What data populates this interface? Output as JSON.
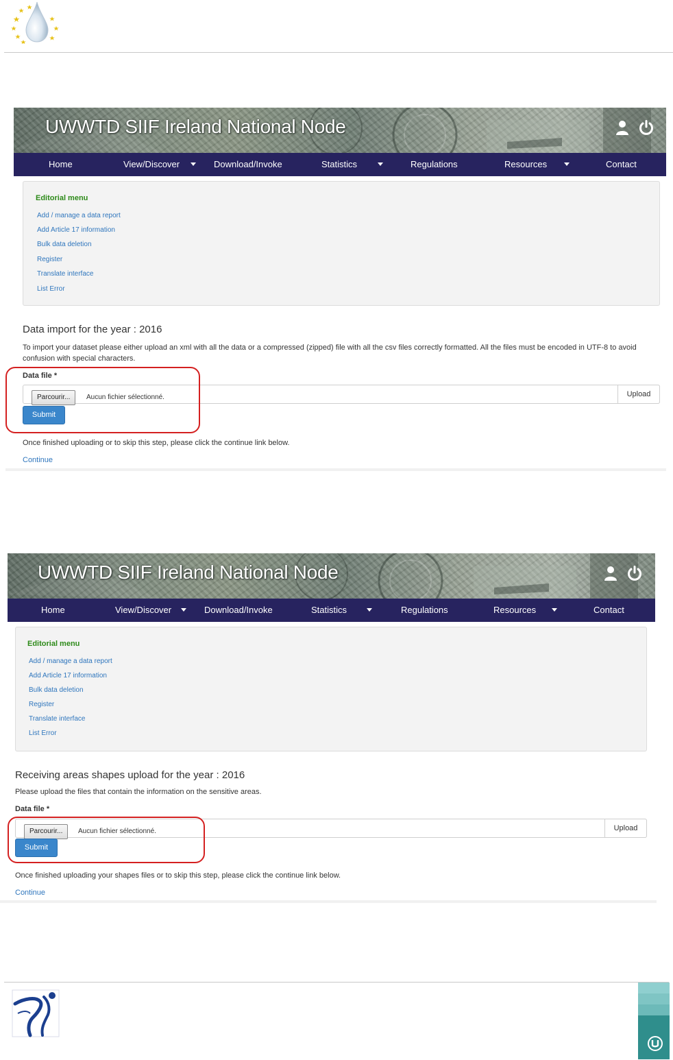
{
  "doc": {
    "header_logo": "eu-water-drop-logo",
    "footer_logo": "swimmer-logo",
    "footer_badge": "u-badge-logo"
  },
  "colors": {
    "nav_background": "#27235f",
    "editorial_title": "#2d8a19",
    "link": "#2f76bd",
    "submit_button": "#3a86cb",
    "highlight_box": "#d42020"
  },
  "screens": [
    {
      "banner_title": "UWWTD SIIF Ireland National Node",
      "banner_icons": [
        "user-icon",
        "power-icon"
      ],
      "nav": {
        "home": "Home",
        "view_discover": "View/Discover",
        "download_invoke": "Download/Invoke",
        "statistics": "Statistics",
        "regulations": "Regulations",
        "resources": "Resources",
        "contact": "Contact"
      },
      "editorial_menu": {
        "title": "Editorial menu",
        "links": [
          "Add / manage a data report",
          "Add Article 17 information",
          "Bulk data deletion",
          "Register",
          "Translate interface",
          "List Error"
        ]
      },
      "section_title": "Data import for the year : 2016",
      "instructions": "To import your dataset please either upload an xml with all the data or a compressed (zipped) file with all the csv files correctly formatted. All the files must be encoded in UTF-8 to avoid confusion with special characters.",
      "field_label": "Data file *",
      "browse_label": "Parcourir...",
      "file_status": "Aucun fichier sélectionné.",
      "upload_label": "Upload",
      "submit_label": "Submit",
      "after_text": "Once finished uploading or to skip this step, please click the continue link below.",
      "continue_label": "Continue"
    },
    {
      "banner_title": "UWWTD SIIF Ireland National Node",
      "banner_icons": [
        "user-icon",
        "power-icon"
      ],
      "nav": {
        "home": "Home",
        "view_discover": "View/Discover",
        "download_invoke": "Download/Invoke",
        "statistics": "Statistics",
        "regulations": "Regulations",
        "resources": "Resources",
        "contact": "Contact"
      },
      "editorial_menu": {
        "title": "Editorial menu",
        "links": [
          "Add / manage a data report",
          "Add Article 17 information",
          "Bulk data deletion",
          "Register",
          "Translate interface",
          "List Error"
        ]
      },
      "section_title": "Receiving areas shapes upload for the year : 2016",
      "instructions": "Please upload the files that contain the information on the sensitive areas.",
      "field_label": "Data file *",
      "browse_label": "Parcourir...",
      "file_status": "Aucun fichier sélectionné.",
      "upload_label": "Upload",
      "submit_label": "Submit",
      "after_text": "Once finished uploading your shapes files or to skip this step, please click the continue link below.",
      "continue_label": "Continue"
    }
  ]
}
